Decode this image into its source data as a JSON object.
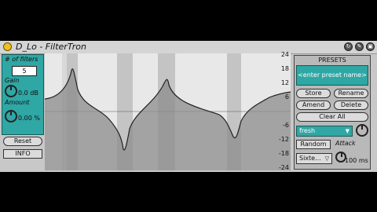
{
  "window": {
    "title": "D_Lo - FilterTron"
  },
  "left": {
    "filters_label": "# of filters",
    "filters_value": "5",
    "gain_label": "Gain",
    "gain_value": "0.0 dB",
    "amount_label": "Amount",
    "amount_value": "0.00 %",
    "reset_label": "Reset",
    "info_label": "INFO"
  },
  "graph": {
    "db_ticks": [
      "24",
      "18",
      "12",
      "6",
      "-6",
      "-12",
      "-18",
      "-24"
    ],
    "line_color": "#222222",
    "fill_color": "#999999"
  },
  "presets": {
    "title": "PRESETS",
    "field_text": "<enter preset name>",
    "store": "Store",
    "rename": "Rename",
    "amend": "Amend",
    "delete": "Delete",
    "clear_all": "Clear All",
    "selected": "fresh",
    "random": "Random",
    "attack_label": "Attack",
    "sixteenth": "Sixte...",
    "attack_value": "100 ms"
  },
  "colors": {
    "teal": "#2fa7a4",
    "power": "#f0c020"
  }
}
